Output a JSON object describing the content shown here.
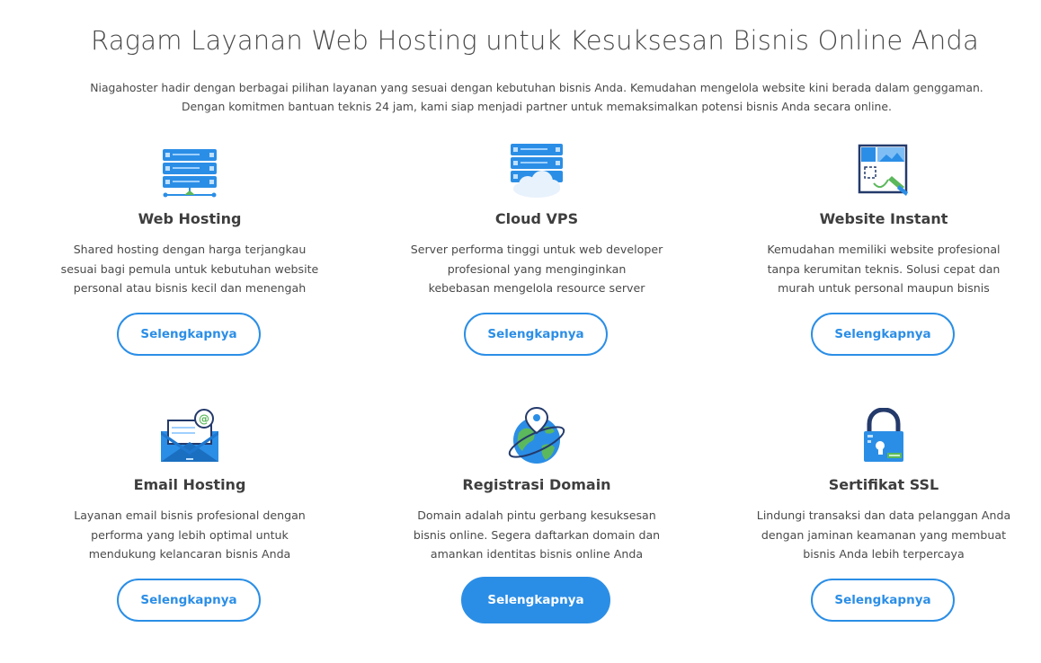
{
  "header": {
    "title": "Ragam Layanan Web Hosting untuk Kesuksesan Bisnis Online Anda",
    "subtitle_line1": "Niagahoster hadir dengan berbagai pilihan layanan yang sesuai dengan kebutuhan bisnis Anda. Kemudahan mengelola website kini berada dalam genggaman.",
    "subtitle_line2": "Dengan komitmen bantuan teknis 24 jam, kami siap menjadi partner untuk memaksimalkan potensi bisnis Anda secara online."
  },
  "services": [
    {
      "title": "Web Hosting",
      "icon": "server-network-icon",
      "desc": [
        "Shared hosting dengan harga terjangkau",
        "sesuai bagi pemula untuk kebutuhan website",
        "personal atau bisnis kecil dan menengah"
      ],
      "button": "Selengkapnya"
    },
    {
      "title": "Cloud VPS",
      "icon": "cloud-server-icon",
      "desc": [
        "Server performa tinggi untuk web developer",
        "profesional yang menginginkan",
        "kebebasan mengelola resource server"
      ],
      "button": "Selengkapnya"
    },
    {
      "title": "Website Instant",
      "icon": "website-builder-icon",
      "desc": [
        "Kemudahan memiliki website profesional",
        "tanpa kerumitan teknis. Solusi cepat dan",
        "murah untuk personal maupun bisnis"
      ],
      "button": "Selengkapnya"
    },
    {
      "title": "Email Hosting",
      "icon": "email-envelope-icon",
      "desc": [
        "Layanan email bisnis profesional dengan",
        "performa yang lebih optimal untuk",
        "mendukung kelancaran bisnis Anda"
      ],
      "button": "Selengkapnya"
    },
    {
      "title": "Registrasi Domain",
      "icon": "globe-pin-icon",
      "desc": [
        "Domain adalah pintu gerbang kesuksesan",
        "bisnis online. Segera daftarkan domain dan",
        "amankan identitas bisnis online Anda"
      ],
      "button": "Selengkapnya"
    },
    {
      "title": "Sertifikat SSL",
      "icon": "padlock-ssl-icon",
      "desc": [
        "Lindungi transaksi dan data pelanggan Anda",
        "dengan jaminan keamanan yang membuat",
        "bisnis Anda lebih terpercaya"
      ],
      "button": "Selengkapnya"
    }
  ],
  "colors": {
    "accent": "#2b8ee6",
    "text": "#4a4a4a",
    "heading": "#3e3e3e",
    "green": "#5cb85c"
  }
}
